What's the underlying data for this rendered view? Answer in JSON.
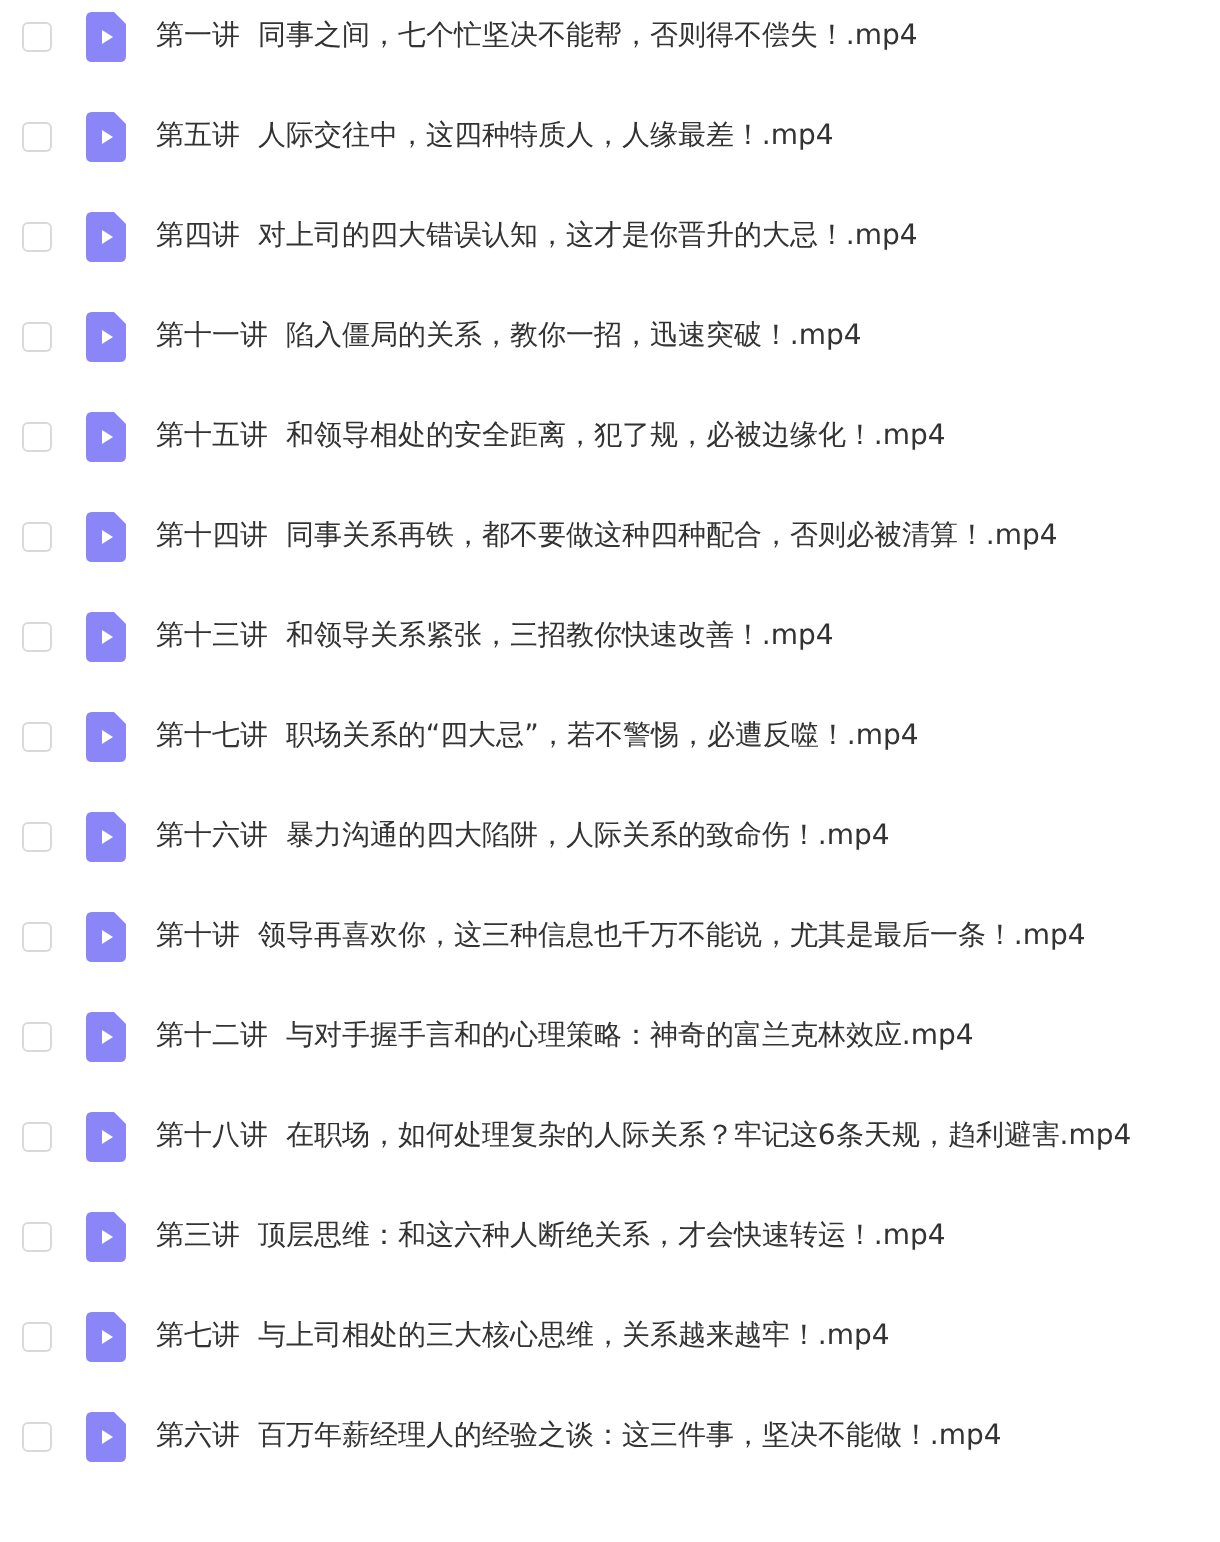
{
  "files": [
    {
      "name": "第一讲  同事之间，七个忙坚决不能帮，否则得不偿失！.mp4",
      "checked": false
    },
    {
      "name": "第五讲  人际交往中，这四种特质人，人缘最差！.mp4",
      "checked": false
    },
    {
      "name": "第四讲  对上司的四大错误认知，这才是你晋升的大忌！.mp4",
      "checked": false
    },
    {
      "name": "第十一讲  陷入僵局的关系，教你一招，迅速突破！.mp4",
      "checked": false
    },
    {
      "name": "第十五讲  和领导相处的安全距离，犯了规，必被边缘化！.mp4",
      "checked": false
    },
    {
      "name": "第十四讲  同事关系再铁，都不要做这种四种配合，否则必被清算！.mp4",
      "checked": false
    },
    {
      "name": "第十三讲  和领导关系紧张，三招教你快速改善！.mp4",
      "checked": false
    },
    {
      "name": "第十七讲  职场关系的“四大忌”，若不警惕，必遭反噬！.mp4",
      "checked": false
    },
    {
      "name": "第十六讲  暴力沟通的四大陷阱，人际关系的致命伤！.mp4",
      "checked": false
    },
    {
      "name": "第十讲  领导再喜欢你，这三种信息也千万不能说，尤其是最后一条！.mp4",
      "checked": false
    },
    {
      "name": "第十二讲  与对手握手言和的心理策略：神奇的富兰克林效应.mp4",
      "checked": false
    },
    {
      "name": "第十八讲  在职场，如何处理复杂的人际关系？牢记这6条天规，趋利避害.mp4",
      "checked": false
    },
    {
      "name": "第三讲  顶层思维：和这六种人断绝关系，才会快速转运！.mp4",
      "checked": false
    },
    {
      "name": "第七讲  与上司相处的三大核心思维，关系越来越牢！.mp4",
      "checked": false
    },
    {
      "name": "第六讲  百万年薪经理人的经验之谈：这三件事，坚决不能做！.mp4",
      "checked": false
    }
  ]
}
